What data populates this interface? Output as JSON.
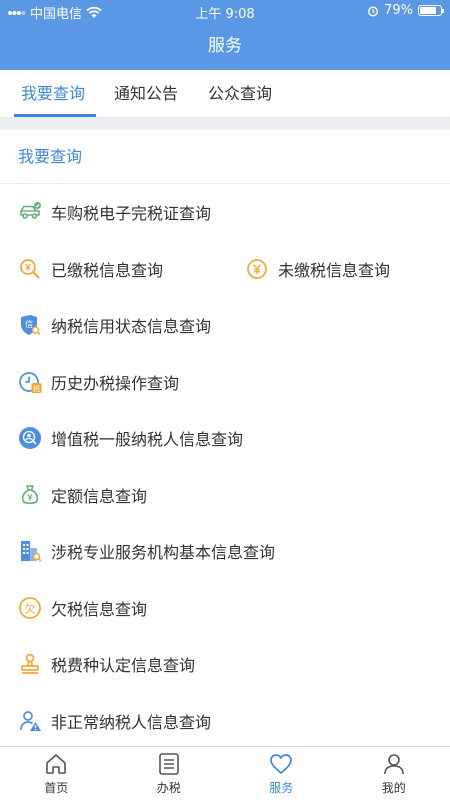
{
  "status": {
    "carrier": "中国电信",
    "time": "上午 9:08",
    "battery": "79%",
    "battery_level": 0.79
  },
  "header": {
    "title": "服务"
  },
  "tabs": [
    {
      "label": "我要查询",
      "active": true
    },
    {
      "label": "通知公告",
      "active": false
    },
    {
      "label": "公众查询",
      "active": false
    }
  ],
  "section": {
    "title": "我要查询"
  },
  "items": [
    {
      "label": "车购税电子完税证查询",
      "icon": "car-icon"
    },
    {
      "label": "已缴税信息查询",
      "icon": "yen-search-icon"
    },
    {
      "label": "未缴税信息查询",
      "icon": "yen-coin-icon"
    },
    {
      "label": "纳税信用状态信息查询",
      "icon": "credit-shield-icon"
    },
    {
      "label": "历史办税操作查询",
      "icon": "clock-tax-icon"
    },
    {
      "label": "增值税一般纳税人信息查询",
      "icon": "person-search-icon"
    },
    {
      "label": "定额信息查询",
      "icon": "money-bag-icon"
    },
    {
      "label": "涉税专业服务机构基本信息查询",
      "icon": "building-icon"
    },
    {
      "label": "欠税信息查询",
      "icon": "owe-icon"
    },
    {
      "label": "税费种认定信息查询",
      "icon": "stamp-icon"
    },
    {
      "label": "非正常纳税人信息查询",
      "icon": "person-warning-icon"
    }
  ],
  "tabbar": [
    {
      "label": "首页",
      "icon": "home-icon",
      "active": false
    },
    {
      "label": "办税",
      "icon": "list-icon",
      "active": false
    },
    {
      "label": "服务",
      "icon": "heart-icon",
      "active": true
    },
    {
      "label": "我的",
      "icon": "user-icon",
      "active": false
    }
  ],
  "colors": {
    "primary": "#5a98e6",
    "accent": "#3f86d9",
    "orange": "#f0a830"
  }
}
